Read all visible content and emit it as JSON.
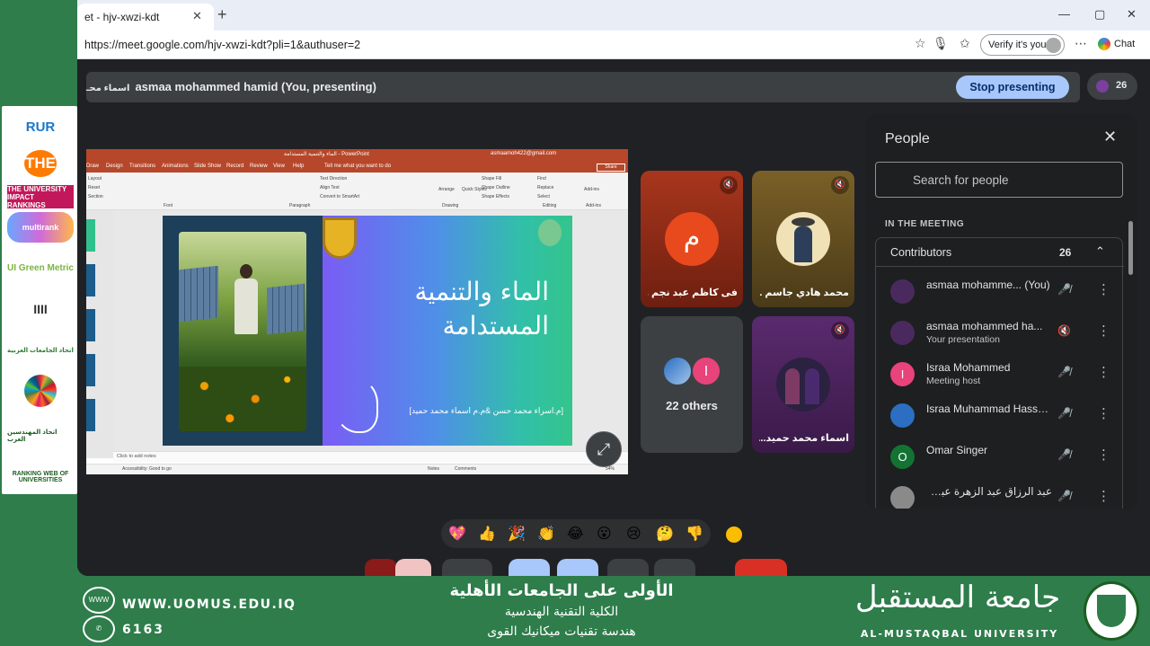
{
  "browser": {
    "tab_title": "et - hjv-xwzi-kdt",
    "tab_close": "✕",
    "new_tab": "+",
    "window_controls": [
      "—",
      "▢",
      "✕"
    ],
    "url": "https://meet.google.com/hjv-xwzi-kdt?pli=1&authuser=2",
    "verify_label": "Verify it's you",
    "chat_label": "Chat"
  },
  "meet": {
    "presenter_arabic": "اسماء محـ",
    "presenter_text": "asmaa mohammed hamid (You, presenting)",
    "stop_presenting": "Stop presenting",
    "people_count": "26"
  },
  "ppt": {
    "window_title": "الماء والتنمية المستدامة - PowerPoint",
    "account": "asmaamoh422@gmail.com",
    "share": "Share",
    "tabs": [
      "Draw",
      "Design",
      "Transitions",
      "Animations",
      "Slide Show",
      "Record",
      "Review",
      "View",
      "Help",
      "Tell me what you want to do"
    ],
    "ribbon_groups": [
      "Font",
      "Paragraph",
      "Drawing",
      "Editing",
      "Add-ins"
    ],
    "ribbon_items": [
      "Layout",
      "Reset",
      "Section",
      "Arrange",
      "Quick Styles",
      "Shape Fill",
      "Shape Outline",
      "Shape Effects",
      "Find",
      "Replace",
      "Select",
      "Add-ins",
      "Text Direction",
      "Align Text",
      "Convert to SmartArt"
    ],
    "slide_title": "الماء والتنمية المستدامة",
    "slide_authors": "[م.اسراء محمد حسن &م.م اسماء محمد حميد]",
    "notes_placeholder": "Click to add notes",
    "status_left": "Accessibility: Good to go",
    "status_notes": "Notes",
    "status_comments": "Comments",
    "status_zoom": "54%"
  },
  "tiles": [
    {
      "initial": "م",
      "name": "فى كاظم عبد نجم ...",
      "color": "#e8491d"
    },
    {
      "name": "محمد هادي جاسم ..."
    },
    {
      "others_initial": "I",
      "others_label": "22 others"
    },
    {
      "name": "اسماء محمد حميد..."
    }
  ],
  "people_panel": {
    "title": "People",
    "search_placeholder": "Search for people",
    "section_label": "IN THE MEETING",
    "group_label": "Contributors",
    "group_count": "26",
    "participants": [
      {
        "name": "asmaa mohamme... (You)",
        "sub": "",
        "initial": "",
        "color": "#4a2a5e"
      },
      {
        "name": "asmaa mohammed ha...",
        "sub": "Your presentation",
        "initial": "",
        "color": "#4a2a5e"
      },
      {
        "name": "Israa Mohammed",
        "sub": "Meeting host",
        "initial": "I",
        "color": "#e8437a"
      },
      {
        "name": "Israa Muhammad Hassa...",
        "sub": "",
        "initial": "",
        "color": "#2b6ec2"
      },
      {
        "name": "Omar Singer",
        "sub": "",
        "initial": "O",
        "color": "#137333"
      },
      {
        "name": "عبد الرزاق عبد الزهرة عبد الحسين...",
        "sub": "",
        "initial": "",
        "color": "#8a8a8a"
      }
    ]
  },
  "reactions": [
    "💖",
    "👍",
    "🎉",
    "👏",
    "😂",
    "😮",
    "😢",
    "🤔",
    "👎"
  ],
  "rankings": [
    "RUR",
    "THE",
    "THE UNIVERSITY IMPACT RANKINGS",
    "multirank",
    "UI Green Metric",
    "IIII",
    "اتحاد الجامعات العربية",
    "SDG",
    "اتحاد المهندسين العرب",
    "RANKING WEB OF UNIVERSITIES"
  ],
  "footer": {
    "website": "WWW.UOMUS.EDU.IQ",
    "phone": "6163",
    "line1": "الأولى على الجامعات الأهلية",
    "line2": "الكلية التقنية الهندسية",
    "line3": "هندسة تقنيات ميكانيك القوى",
    "uni_arabic": "جامعة المستقبل",
    "uni_english": "AL-MUSTAQBAL UNIVERSITY",
    "www_icon": "WWW"
  },
  "colors": {
    "brand_green": "#2e7d4b",
    "meet_bg": "#202124",
    "stop_button": "#a8c7fa",
    "ppt_red": "#b7472a"
  }
}
